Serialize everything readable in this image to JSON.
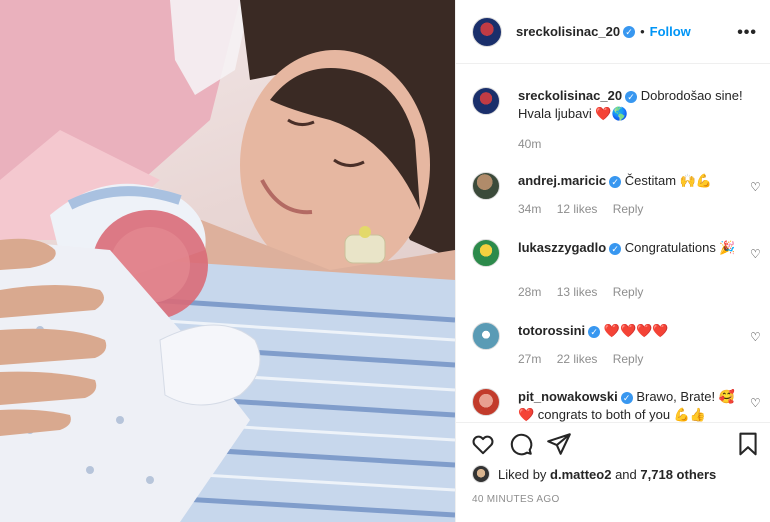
{
  "post": {
    "author": "sreckolisinac_20",
    "verified_mark": "✓",
    "dot": "•",
    "follow_label": "Follow",
    "more_label": "•••",
    "caption_text": "Dobrodošao sine! Hvala ljubavi ❤️🌎",
    "caption_time": "40m"
  },
  "comments": [
    {
      "user": "andrej.maricic",
      "text": "Čestitam 🙌💪",
      "time": "34m",
      "likes": "12 likes",
      "reply": "Reply"
    },
    {
      "user": "lukaszzygadlo",
      "text": "Congratulations 🎉",
      "time": "28m",
      "likes": "13 likes",
      "reply": "Reply"
    },
    {
      "user": "totorossini",
      "text": "❤️❤️❤️❤️",
      "time": "27m",
      "likes": "22 likes",
      "reply": "Reply"
    },
    {
      "user": "pit_nowakowski",
      "text": "Brawo, Brate! 🥰❤️ congrats to both of you 💪👍",
      "time": "",
      "likes": "",
      "reply": ""
    }
  ],
  "likes_line": {
    "prefix": "Liked by ",
    "user": "d.matteo2",
    "middle": " and ",
    "count": "7,718 others"
  },
  "timestamp": "40 MINUTES AGO",
  "icons": [
    "heart-icon",
    "comment-icon",
    "share-icon",
    "bookmark-icon",
    "more-icon",
    "verified-icon"
  ],
  "colors": {
    "link": "#0095f6",
    "verified": "#3897f0",
    "muted": "#8e8e8e",
    "text": "#262626",
    "heart_red": "#ed4956"
  }
}
